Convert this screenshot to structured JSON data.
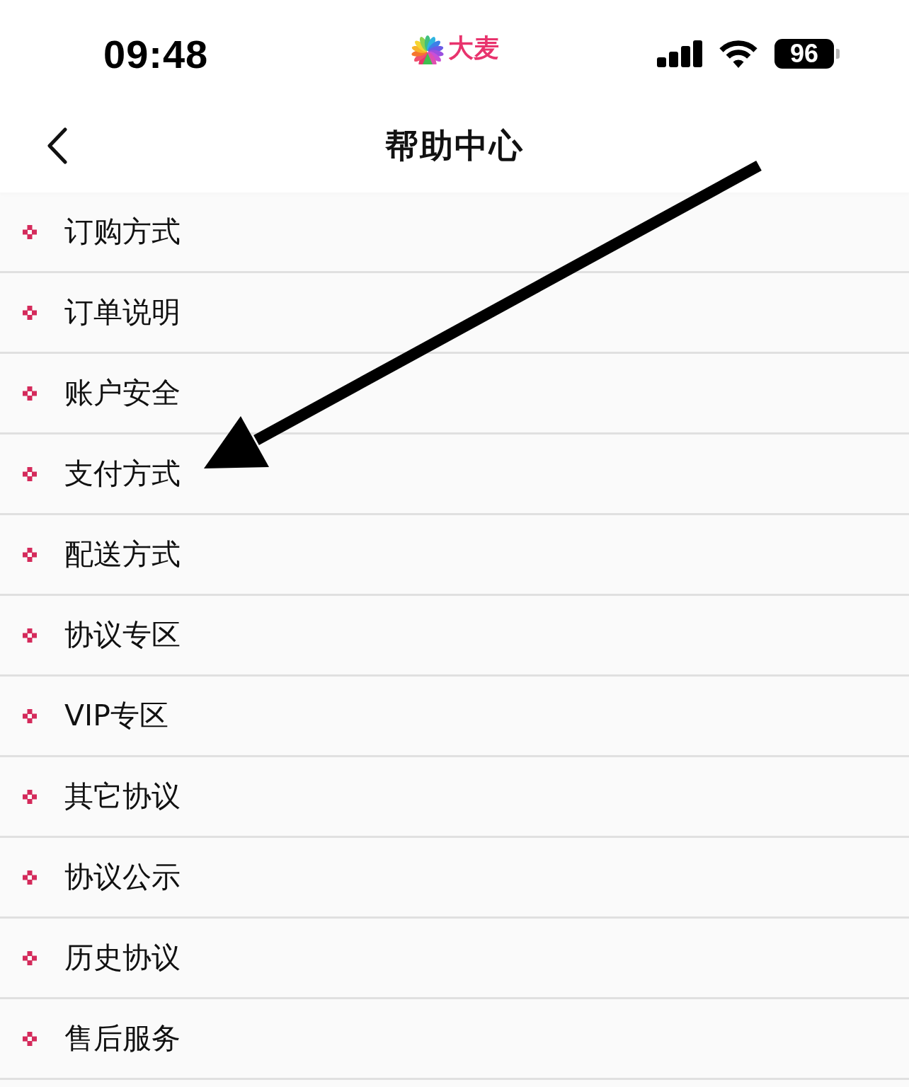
{
  "status_bar": {
    "time": "09:48",
    "app_label": "大麦",
    "battery": "96"
  },
  "nav_bar": {
    "title": "帮助中心"
  },
  "help_topics": [
    {
      "label": "订购方式",
      "arrow_points_here": false
    },
    {
      "label": "订单说明",
      "arrow_points_here": false
    },
    {
      "label": "账户安全",
      "arrow_points_here": false
    },
    {
      "label": "支付方式",
      "arrow_points_here": true
    },
    {
      "label": "配送方式",
      "arrow_points_here": false
    },
    {
      "label": "协议专区",
      "arrow_points_here": false
    },
    {
      "label": "VIP专区",
      "arrow_points_here": false
    },
    {
      "label": "其它协议",
      "arrow_points_here": false
    },
    {
      "label": "协议公示",
      "arrow_points_here": false
    },
    {
      "label": "历史协议",
      "arrow_points_here": false
    },
    {
      "label": "售后服务",
      "arrow_points_here": false
    }
  ]
}
